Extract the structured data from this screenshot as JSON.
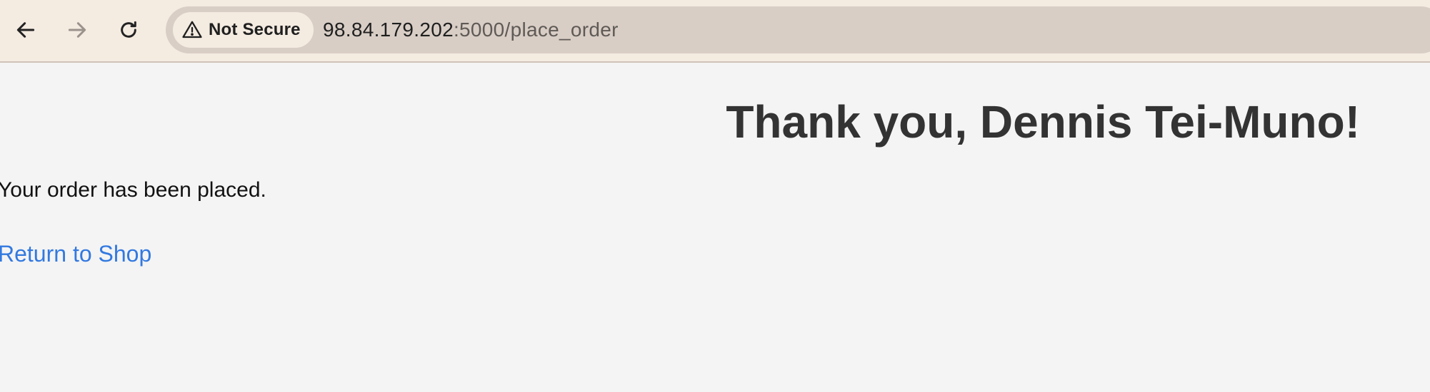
{
  "browser": {
    "security_label": "Not Secure",
    "url_host": "98.84.179.202",
    "url_rest": ":5000/place_order"
  },
  "page": {
    "heading": "Thank you, Dennis Tei-Muno!",
    "message": "Your order has been placed.",
    "return_link": "Return to Shop"
  },
  "colors": {
    "toolbar_bg": "#f4ebe1",
    "omnibox_bg": "#d9cec6",
    "page_bg": "#f4f4f4",
    "link": "#3279e0",
    "heading": "#333333"
  },
  "icons": {
    "back": "arrow-left-icon",
    "forward": "arrow-right-icon",
    "reload": "reload-icon",
    "security": "warning-triangle-icon"
  }
}
